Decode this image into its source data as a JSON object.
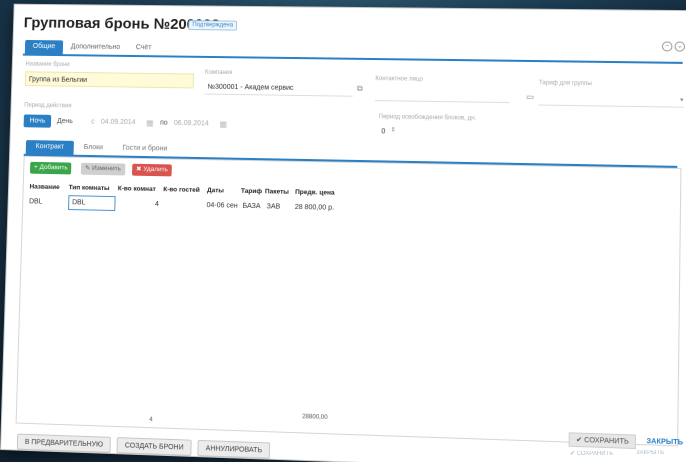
{
  "window": {
    "title": "Групповая бронь №200002",
    "status_badge": "Подтверждена",
    "minimize_icon": "minus-circle-icon",
    "close_icon": "chevron-circle-icon"
  },
  "tabs": [
    {
      "label": "Общие",
      "active": true
    },
    {
      "label": "Дополнительно",
      "active": false
    },
    {
      "label": "Счёт",
      "active": false
    }
  ],
  "fields": {
    "name_label": "Название брони",
    "name_value": "Группа из Бельгии",
    "company_label": "Компания",
    "company_value": "№300001 - Академ сервис",
    "contact_label": "Контактное лицо",
    "contact_value": "",
    "tariff_label": "Тариф для группы",
    "tariff_value": "",
    "period_label": "Период действия",
    "release_label": "Период освобождения блоков, дн.",
    "release_value": "0"
  },
  "period": {
    "mode_night": "Ночь",
    "mode_day": "День",
    "from_label": "с",
    "from_date": "04.09.2014",
    "to_label": "по",
    "to_date": "06.09.2014"
  },
  "inner_tabs": [
    {
      "label": "Контракт",
      "active": true
    },
    {
      "label": "Блоки",
      "active": false
    },
    {
      "label": "Гости и брони",
      "active": false
    }
  ],
  "toolbar": {
    "add": "+ Добавить",
    "edit": "✎ Изменить",
    "delete": "✖ Удалить"
  },
  "table": {
    "headers": [
      "Название",
      "Тип комнаты",
      "К-во комнат",
      "К-во гостей",
      "Даты",
      "Тариф",
      "Пакеты",
      "Предв. цена"
    ],
    "rows": [
      [
        "DBL",
        "DBL",
        "",
        "4",
        "04-06 сен",
        "БАЗА",
        "ЗАВ",
        "28 800,00 р."
      ]
    ],
    "total_guests": "4",
    "total_price": "28800,00"
  },
  "actions": {
    "save": "✔ СОХРАНИТЬ",
    "close": "ЗАКРЫТЬ"
  },
  "bottom_buttons": [
    "В ПРЕДВАРИТЕЛЬНУЮ",
    "СОЗДАТЬ БРОНИ",
    "АННУЛИРОВАТЬ"
  ],
  "reflection": {
    "save": "✔ СОХРАНИТЬ",
    "close": "ЗАКРЫТЬ"
  }
}
